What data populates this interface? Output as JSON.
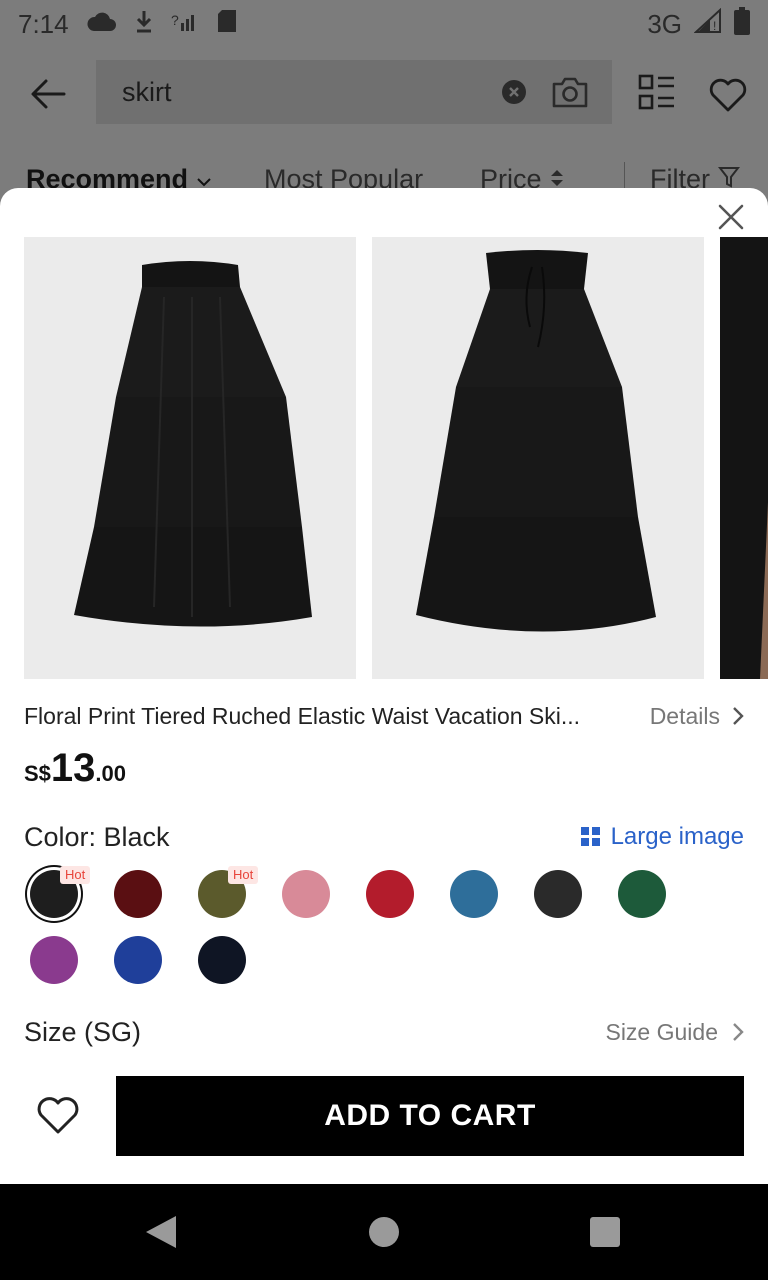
{
  "status_bar": {
    "time": "7:14",
    "network": "3G"
  },
  "search": {
    "query": "skirt"
  },
  "sort_bar": {
    "recommend": "Recommend",
    "most_popular": "Most Popular",
    "price": "Price",
    "filter": "Filter"
  },
  "product": {
    "title": "Floral Print Tiered Ruched Elastic Waist Vacation Ski...",
    "details_label": "Details",
    "price_currency": "S$",
    "price_integer": "13",
    "price_decimal": ".00",
    "color_label": "Color: Black",
    "large_image_label": "Large image",
    "size_label": "Size (SG)",
    "size_guide_label": "Size Guide",
    "add_to_cart_label": "ADD TO CART",
    "hot_badge": "Hot",
    "swatches": [
      {
        "name": "Black",
        "color": "#1e1e1e",
        "selected": true,
        "hot": true
      },
      {
        "name": "Burgundy",
        "color": "#5a0f12",
        "selected": false,
        "hot": false
      },
      {
        "name": "Olive",
        "color": "#5b5a2c",
        "selected": false,
        "hot": true
      },
      {
        "name": "Pink",
        "color": "#d88a98",
        "selected": false,
        "hot": false
      },
      {
        "name": "Red floral",
        "color": "#b31c2c",
        "selected": false,
        "hot": false
      },
      {
        "name": "Blue floral",
        "color": "#2e6e9a",
        "selected": false,
        "hot": false
      },
      {
        "name": "Black floral",
        "color": "#2a2a2a",
        "selected": false,
        "hot": false
      },
      {
        "name": "Green floral",
        "color": "#1d5a3a",
        "selected": false,
        "hot": false
      },
      {
        "name": "Purple floral",
        "color": "#8a3a8e",
        "selected": false,
        "hot": false
      },
      {
        "name": "Royal blue",
        "color": "#1f3f9a",
        "selected": false,
        "hot": false
      },
      {
        "name": "Navy",
        "color": "#0f1524",
        "selected": false,
        "hot": false
      }
    ]
  },
  "colors": {
    "accent_blue": "#2a62c9",
    "hot_red": "#e8443a",
    "cart_bg": "#000000"
  }
}
